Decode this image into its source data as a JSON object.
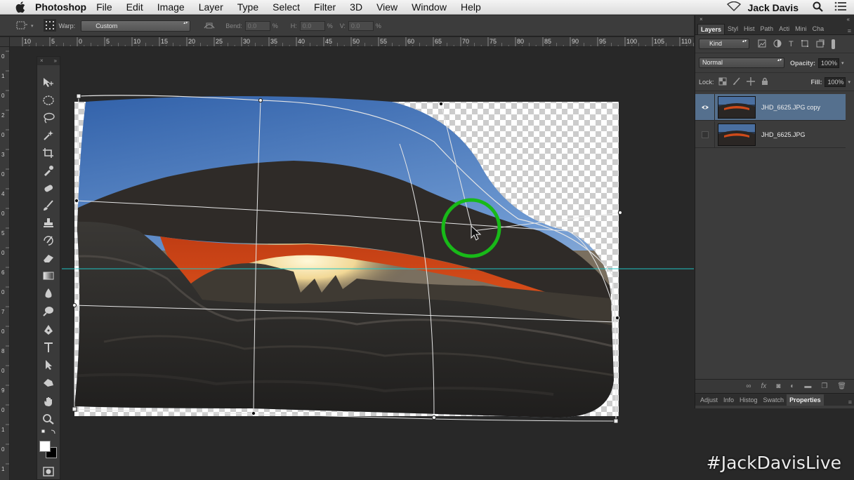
{
  "menubar": {
    "app_name": "Photoshop",
    "items": [
      "File",
      "Edit",
      "Image",
      "Layer",
      "Type",
      "Select",
      "Filter",
      "3D",
      "View",
      "Window",
      "Help"
    ],
    "user": "Jack Davis",
    "icons": [
      "apple-icon",
      "wifi-icon",
      "search-icon",
      "list-icon"
    ]
  },
  "options": {
    "warp_label": "Warp:",
    "warp_value": "Custom",
    "bend_label": "Bend:",
    "bend_value": "0.0",
    "h_label": "H:",
    "h_value": "0.0",
    "v_label": "V:",
    "v_value": "0.0",
    "pct": "%"
  },
  "ruler": {
    "top_ticks": [
      "10",
      "5",
      "0",
      "5",
      "10",
      "15",
      "20",
      "25",
      "30",
      "35",
      "40",
      "45",
      "50",
      "55",
      "60",
      "65",
      "70",
      "75",
      "80",
      "85",
      "90",
      "95",
      "100",
      "105",
      "110"
    ],
    "left_ticks": [
      "0",
      "1",
      "0",
      "2",
      "0",
      "3",
      "0",
      "4",
      "0",
      "5",
      "0",
      "6",
      "0",
      "7",
      "0",
      "8",
      "0",
      "9",
      "0",
      "1",
      "0",
      "1"
    ]
  },
  "tools": {
    "header_close": "×",
    "header_collapse": "»",
    "items": [
      "move-tool-icon",
      "elliptical-marquee-icon",
      "lasso-icon",
      "quick-selection-icon",
      "crop-icon",
      "eyedropper-icon",
      "spot-healing-icon",
      "brush-icon",
      "clone-stamp-icon",
      "history-brush-icon",
      "eraser-icon",
      "gradient-icon",
      "blur-icon",
      "dodge-icon",
      "pen-icon",
      "type-icon",
      "path-selection-icon",
      "shape-icon",
      "hand-rotate-icon",
      "zoom-icon"
    ]
  },
  "panel": {
    "close": "×",
    "collapse": "«",
    "tabs": [
      "Layers",
      "Styl",
      "Hist",
      "Path",
      "Acti",
      "Mini",
      "Cha"
    ],
    "kind_label": "Kind",
    "blend_mode": "Normal",
    "opacity_label": "Opacity:",
    "opacity_value": "100%",
    "lock_label": "Lock:",
    "fill_label": "Fill:",
    "fill_value": "100%",
    "layers": [
      {
        "name": "JHD_6625.JPG copy",
        "visible": true,
        "selected": true
      },
      {
        "name": "JHD_6625.JPG",
        "visible": false,
        "selected": false
      }
    ],
    "bottom_icons": [
      "link-icon",
      "fx-icon",
      "mask-icon",
      "adjustment-icon",
      "folder-icon",
      "new-layer-icon",
      "trash-icon"
    ],
    "bottom_tabs": [
      "Adjust",
      "Info",
      "Histog",
      "Swatch",
      "Properties"
    ],
    "fx_text": "fx"
  },
  "watermark": "#JackDavisLive",
  "colors": {
    "guide": "#1fc4c4",
    "highlight_circle": "#18b918",
    "selected_layer": "#55708e"
  }
}
